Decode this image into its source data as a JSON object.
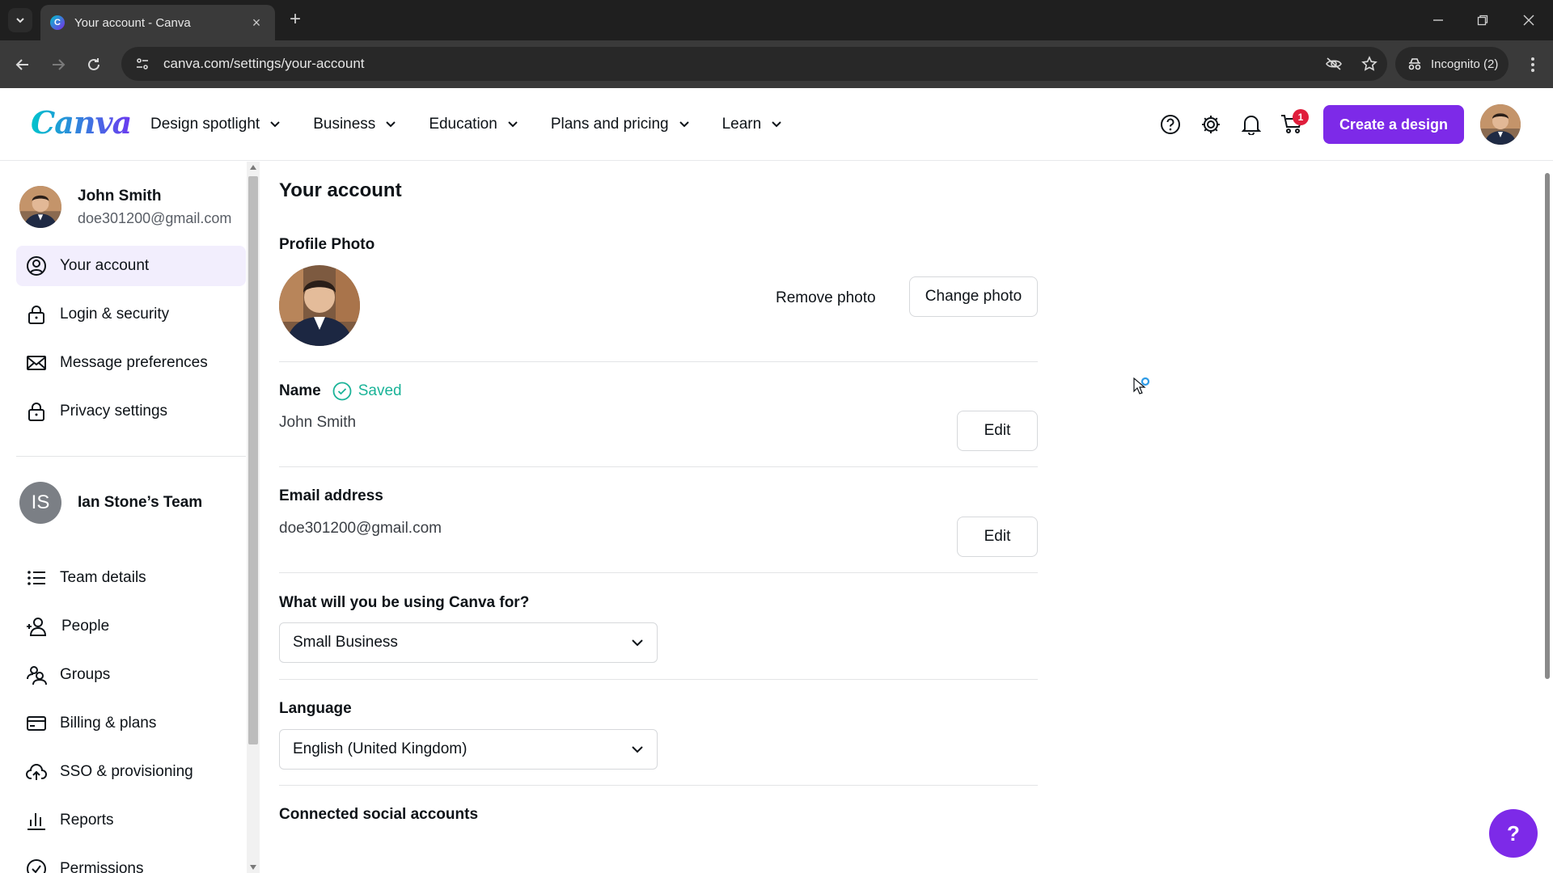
{
  "browser": {
    "tab_title": "Your account - Canva",
    "url": "canva.com/settings/your-account",
    "incognito_label": "Incognito (2)"
  },
  "header": {
    "nav": [
      {
        "label": "Design spotlight"
      },
      {
        "label": "Business"
      },
      {
        "label": "Education"
      },
      {
        "label": "Plans and pricing"
      },
      {
        "label": "Learn"
      }
    ],
    "cart_count": "1",
    "create_label": "Create a design",
    "brand_color": "#7d2ae8"
  },
  "sidebar": {
    "user_name": "John Smith",
    "user_email": "doe301200@gmail.com",
    "account_items": [
      {
        "label": "Your account",
        "icon": "user-circle-icon",
        "active": true
      },
      {
        "label": "Login & security",
        "icon": "lock-icon"
      },
      {
        "label": "Message preferences",
        "icon": "envelope-icon"
      },
      {
        "label": "Privacy settings",
        "icon": "lock-icon"
      }
    ],
    "team_initials": "IS",
    "team_name": "Ian Stone’s Team",
    "team_items": [
      {
        "label": "Team details",
        "icon": "list-icon"
      },
      {
        "label": "People",
        "icon": "person-add-icon"
      },
      {
        "label": "Groups",
        "icon": "groups-icon"
      },
      {
        "label": "Billing & plans",
        "icon": "credit-card-icon"
      },
      {
        "label": "SSO & provisioning",
        "icon": "cloud-upload-icon"
      },
      {
        "label": "Reports",
        "icon": "bar-chart-icon"
      },
      {
        "label": "Permissions",
        "icon": "check-circle-icon"
      }
    ]
  },
  "main": {
    "title": "Your account",
    "profile_photo_label": "Profile Photo",
    "remove_photo_label": "Remove photo",
    "change_photo_label": "Change photo",
    "name_label": "Name",
    "saved_label": "Saved",
    "name_value": "John Smith",
    "edit_label": "Edit",
    "email_label": "Email address",
    "email_value": "doe301200@gmail.com",
    "usage_label": "What will you be using Canva for?",
    "usage_value": "Small Business",
    "language_label": "Language",
    "language_value": "English (United Kingdom)",
    "connected_label": "Connected social accounts"
  },
  "help_fab_label": "?"
}
